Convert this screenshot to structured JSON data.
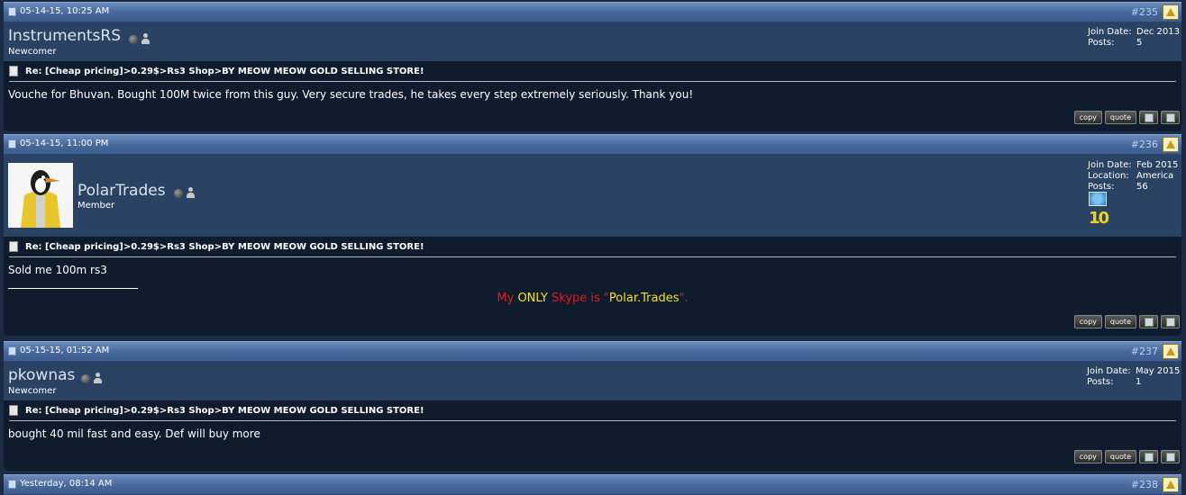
{
  "posts": [
    {
      "date": "05-14-15, 10:25 AM",
      "number": "#235",
      "username": "InstrumentsRS",
      "usertitle": "Newcomer",
      "info": [
        {
          "label": "Join Date:",
          "value": "Dec 2013"
        },
        {
          "label": "Posts:",
          "value": "5"
        }
      ],
      "title": "Re: [Cheap pricing]>0.29$>Rs3 Shop>BY MEOW MEOW GOLD SELLING STORE!",
      "message": "Vouche for Bhuvan. Bought 100M twice from this guy. Very secure trades, he takes every step extremely seriously. Thank you!"
    },
    {
      "date": "05-14-15, 11:00 PM",
      "number": "#236",
      "username": "PolarTrades",
      "usertitle": "Member",
      "info": [
        {
          "label": "Join Date:",
          "value": "Feb 2015"
        },
        {
          "label": "Location:",
          "value": "America"
        },
        {
          "label": "Posts:",
          "value": "56"
        }
      ],
      "title": "Re: [Cheap pricing]>0.29$>Rs3 Shop>BY MEOW MEOW GOLD SELLING STORE!",
      "message": "Sold me 100m rs3",
      "signature": {
        "part1": "My ",
        "part2": "ONLY",
        "part3": " Skype is \"",
        "part4": "Polar.Trades",
        "part5": "\"."
      },
      "badge_text": "10"
    },
    {
      "date": "05-15-15, 01:52 AM",
      "number": "#237",
      "username": "pkownas",
      "usertitle": "Newcomer",
      "info": [
        {
          "label": "Join Date:",
          "value": "May 2015"
        },
        {
          "label": "Posts:",
          "value": "1"
        }
      ],
      "title": "Re: [Cheap pricing]>0.29$>Rs3 Shop>BY MEOW MEOW GOLD SELLING STORE!",
      "message": "bought 40 mil fast and easy. Def will buy more"
    }
  ],
  "actions": {
    "copy": "copy",
    "quote": "quote"
  },
  "next_post": {
    "date": "Yesterday, 08:14 AM",
    "number": "#238"
  },
  "colors": {
    "header_bar": "#47679a",
    "user_row": "#2b4362",
    "body": "#0f1c2e",
    "sig_red": "#e0181e",
    "sig_yellow": "#f5e21a"
  }
}
